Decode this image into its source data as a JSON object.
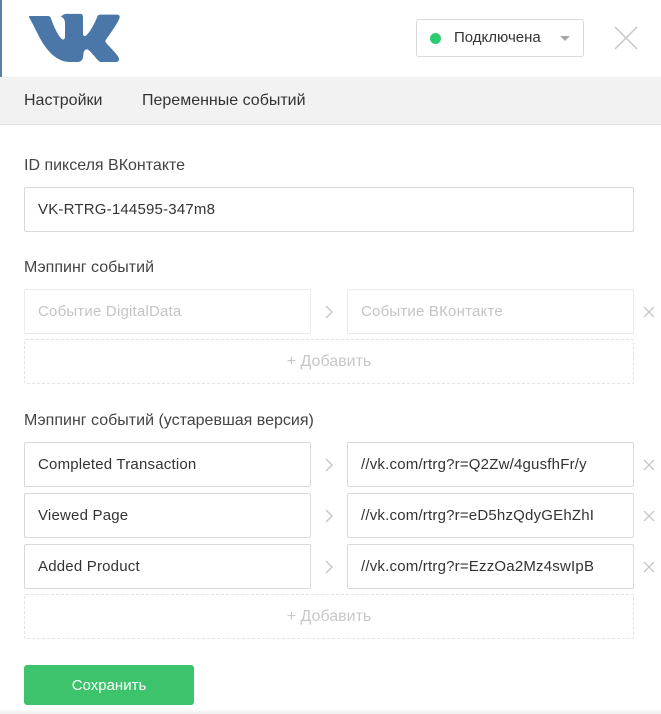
{
  "header": {
    "logo_icon": "vk-logo-icon",
    "status": {
      "label": "Подключена",
      "color": "#2ecc71"
    },
    "close_icon": "close-icon"
  },
  "tabs": [
    {
      "label": "Настройки"
    },
    {
      "label": "Переменные событий"
    }
  ],
  "pixel": {
    "label": "ID пикселя ВКонтакте",
    "value": "VK-RTRG-144595-347m8"
  },
  "event_mapping": {
    "label": "Мэппинг событий",
    "rows": [
      {
        "source_placeholder": "Событие DigitalData",
        "target_placeholder": "Событие ВКонтакте",
        "source": "",
        "target": ""
      }
    ],
    "add_label": "+ Добавить"
  },
  "legacy_mapping": {
    "label": "Мэппинг событий (устаревшая версия)",
    "rows": [
      {
        "source": "Completed Transaction",
        "target": "//vk.com/rtrg?r=Q2Zw/4gusfhFr/y"
      },
      {
        "source": "Viewed Page",
        "target": "//vk.com/rtrg?r=eD5hzQdyGEhZhI"
      },
      {
        "source": "Added Product",
        "target": "//vk.com/rtrg?r=EzzOa2Mz4swIpB"
      }
    ],
    "add_label": "+ Добавить"
  },
  "save_label": "Сохранить",
  "colors": {
    "accent": "#3dc36b",
    "vk_blue": "#4a76a8",
    "status_green": "#2ecc71"
  }
}
